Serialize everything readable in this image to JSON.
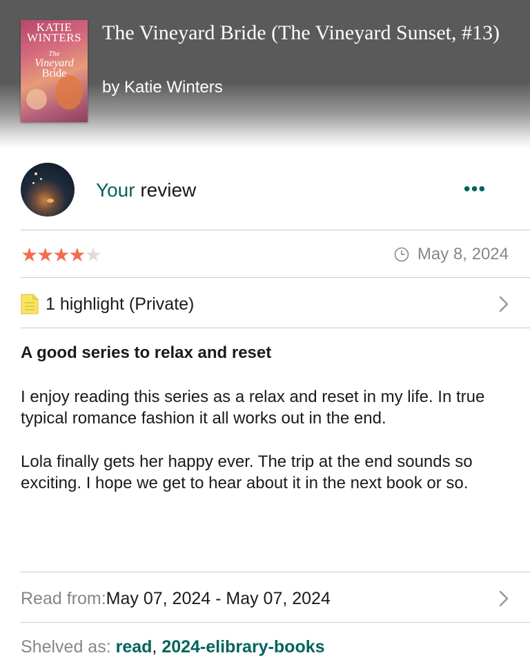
{
  "book": {
    "title": "The Vineyard Bride (The Vineyard Sunset, #13)",
    "author_line": "by Katie Winters",
    "cover": {
      "author_text_1": "KATIE",
      "author_text_2": "WINTERS",
      "title_text_1": "The",
      "title_text_2": "Vineyard",
      "title_text_3": "Bride"
    }
  },
  "review": {
    "heading_your": "Your",
    "heading_rest": " review",
    "more_label": "•••",
    "rating": 4,
    "rating_max": 5,
    "date": "May 8, 2024",
    "highlights": "1 highlight (Private)",
    "title": "A good series to relax and reset",
    "paragraphs": [
      "I enjoy reading this series as a relax and reset in my life. In true typical romance fashion it all works out in the end.",
      "Lola finally gets her happy ever. The trip at the end sounds so exciting. I hope we get to hear about it in the next book or so."
    ]
  },
  "read_dates": {
    "label": "Read from: ",
    "value": "May 07, 2024 - May 07, 2024"
  },
  "shelves": {
    "label": "Shelved as: ",
    "items": [
      "read",
      "2024-elibrary-books"
    ],
    "separator": ", "
  },
  "colors": {
    "accent": "#00635d",
    "star": "#f26d4f",
    "star_empty": "#e0ddd8",
    "highlight_note": "#f7e463"
  },
  "icons": {
    "clock": "clock-icon",
    "note": "note-icon",
    "chevron": "chevron-right-icon",
    "more": "more-icon"
  }
}
